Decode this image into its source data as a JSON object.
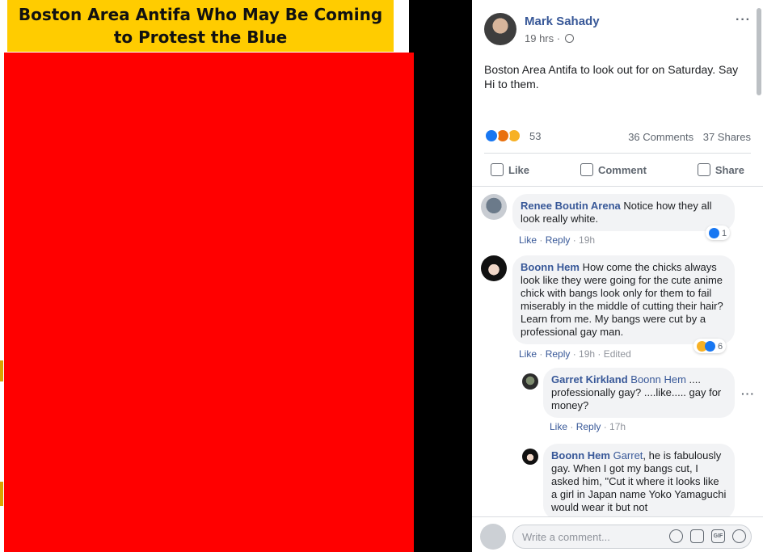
{
  "image": {
    "banner_title": "Boston Area Antifa Who May Be Coming to Protest the Blue"
  },
  "post": {
    "author": "Mark Sahady",
    "time": "19 hrs",
    "time_separator": "·",
    "privacy_icon": "globe-icon",
    "more_icon": "···",
    "text": "Boston Area Antifa to look out for on Saturday. Say Hi to them.",
    "reaction_count": "53",
    "comments_count": "36 Comments",
    "shares_count": "37 Shares",
    "actions": {
      "like": "Like",
      "comment": "Comment",
      "share": "Share"
    }
  },
  "comments": [
    {
      "name": "Renee Boutin Arena",
      "text": "Notice how they all look really white.",
      "like": "Like",
      "reply": "Reply",
      "time": "19h",
      "reaction_count": "1"
    },
    {
      "name": "Boonn Hem",
      "text": "How come the chicks always look like they were going for the cute anime chick with bangs look only for them to fail miserably in the middle of cutting their hair? Learn from me. My bangs were cut by a professional gay man.",
      "like": "Like",
      "reply": "Reply",
      "time": "19h",
      "edited": "Edited",
      "reaction_count": "6"
    }
  ],
  "replies": [
    {
      "name": "Garret Kirkland",
      "mention": "Boonn Hem",
      "text": " .... professionally gay? ....like..... gay for money?",
      "like": "Like",
      "reply": "Reply",
      "time": "17h"
    },
    {
      "name": "Boonn Hem",
      "mention": "Garret",
      "text": ", he is fabulously gay. When I got my bangs cut, I asked him, \"Cut it where it looks like a girl in Japan name Yoko Yamaguchi would wear it but not"
    }
  ],
  "composer": {
    "placeholder": "Write a comment...",
    "gif_label": "GIF"
  },
  "colors": {
    "banner": "#ffcc00",
    "redaction": "#ff0000",
    "link": "#385898"
  }
}
